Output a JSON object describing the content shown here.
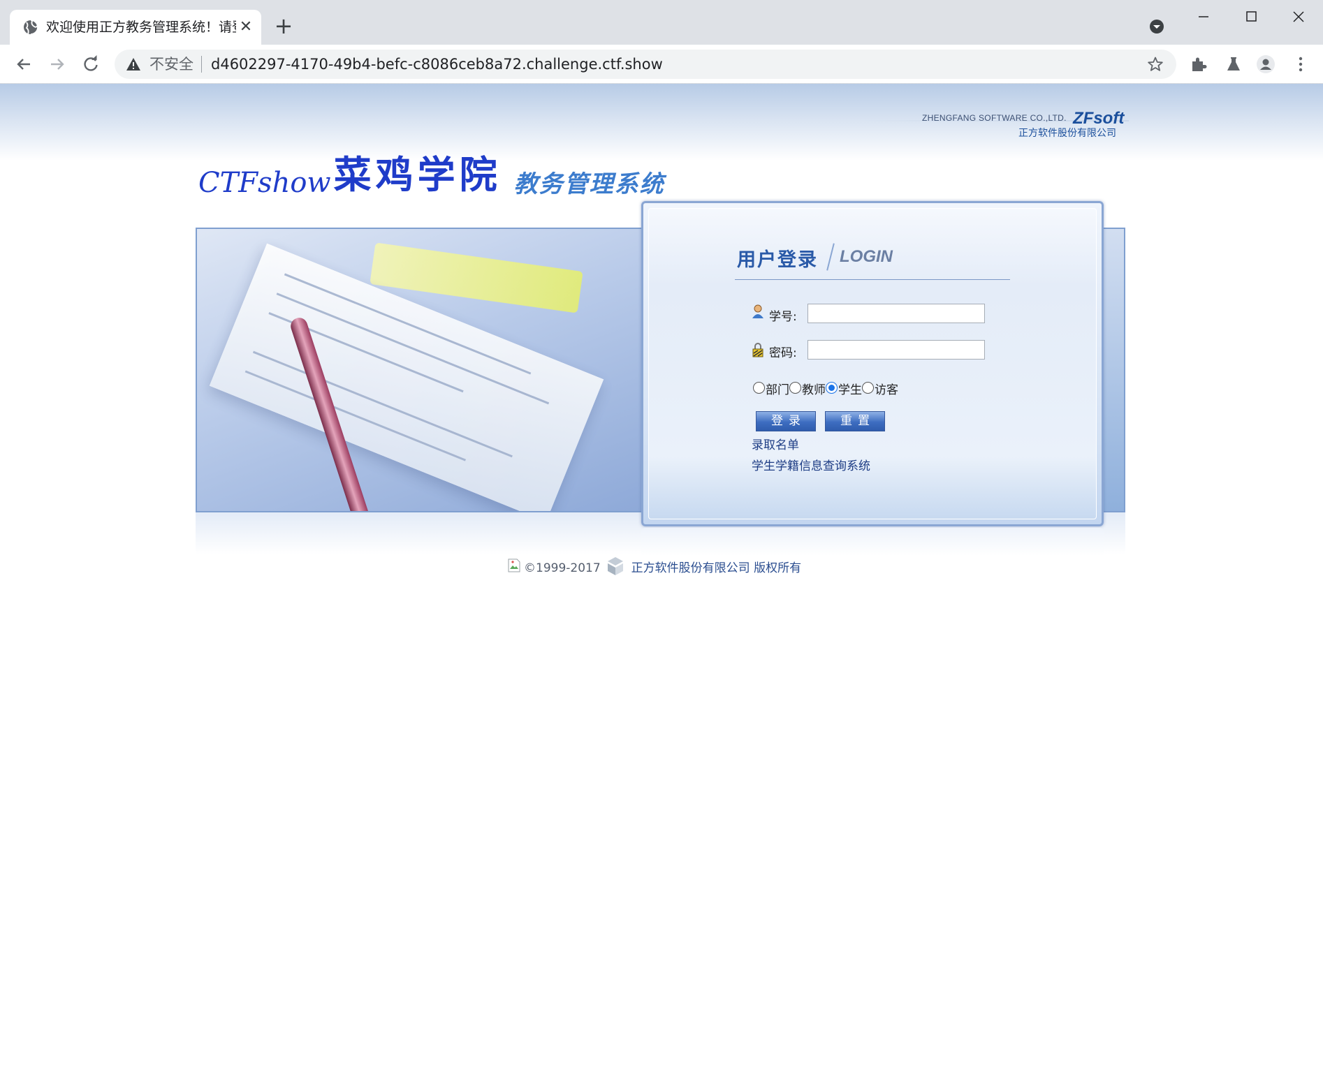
{
  "browser": {
    "tab_title": "欢迎使用正方教务管理系统！请登录",
    "new_tab_label": "+",
    "security_label": "不安全",
    "url": "d4602297-4170-49b4-befc-c8086ceb8a72.challenge.ctf.show"
  },
  "header": {
    "vendor_en": "ZHENGFANG SOFTWARE CO.,LTD.",
    "vendor_logo": "ZFsoft",
    "vendor_cn": "正方软件股份有限公司",
    "brand_prefix": "CTFshow",
    "school_name": "菜鸡学院",
    "system_name": "教务管理系统"
  },
  "login": {
    "title_cn": "用户登录",
    "title_en": "LOGIN",
    "username_label": "学号:",
    "username_value": "",
    "password_label": "密码:",
    "password_value": "",
    "roles": [
      {
        "label": "部门",
        "selected": false
      },
      {
        "label": "教师",
        "selected": false
      },
      {
        "label": "学生",
        "selected": true
      },
      {
        "label": "访客",
        "selected": false
      }
    ],
    "login_button": "登录",
    "reset_button": "重置",
    "links": [
      "录取名单",
      "学生学籍信息查询系统"
    ]
  },
  "footer": {
    "copyright": "©1999-2017",
    "company": "正方软件股份有限公司 版权所有"
  },
  "colors": {
    "accent": "#1f3cc9",
    "panel_border": "#8aa6d3",
    "button": "#3d6dc0",
    "link": "#1e3d85"
  }
}
